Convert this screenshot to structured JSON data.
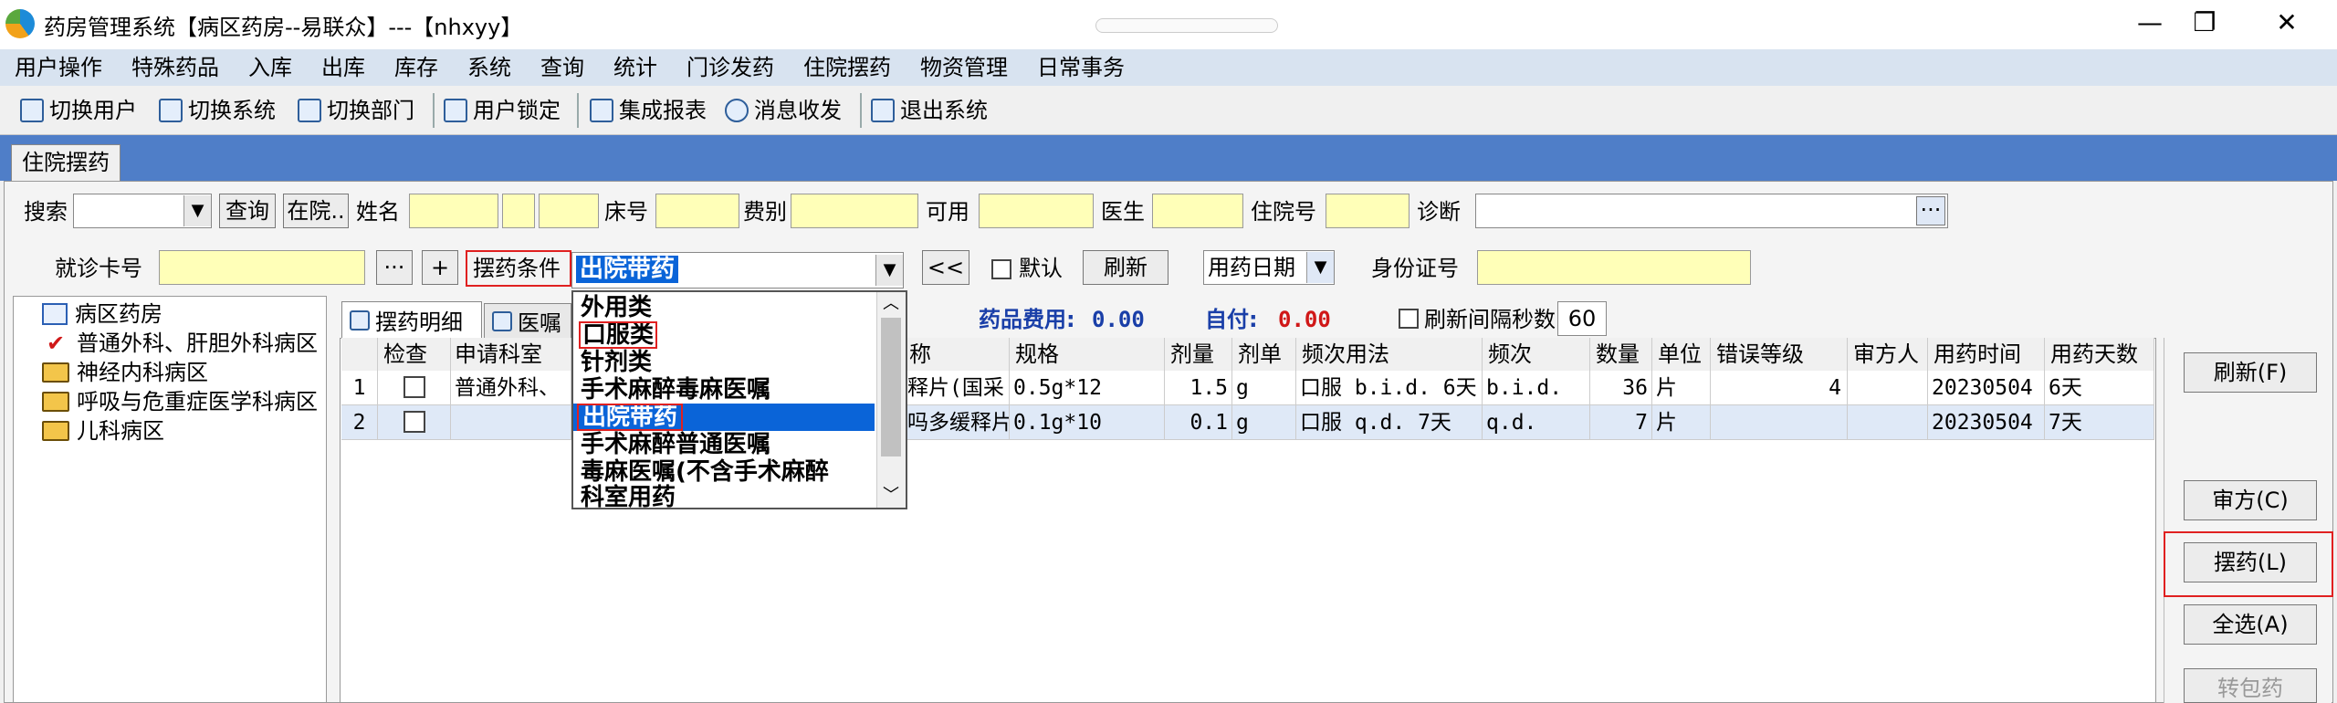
{
  "title_bar": {
    "title": "药房管理系统【病区药房--易联众】---【nhxyy】"
  },
  "menu": [
    "用户操作",
    "特殊药品",
    "入库",
    "出库",
    "库存",
    "系统",
    "查询",
    "统计",
    "门诊发药",
    "住院摆药",
    "物资管理",
    "日常事务"
  ],
  "toolbar": [
    "切换用户",
    "切换系统",
    "切换部门",
    "用户锁定",
    "集成报表",
    "消息收发",
    "退出系统"
  ],
  "tab": "住院摆药",
  "search": {
    "search_label": "搜索",
    "query_btn": "查询",
    "in_hosp_btn": "在院..",
    "name_label": "姓名",
    "bed_label": "床号",
    "fee_label": "费别",
    "available_label": "可用",
    "doctor_label": "医生",
    "inpatient_label": "住院号",
    "diagnosis_label": "诊断",
    "card_label": "就诊卡号",
    "dots": "···",
    "plus": "+",
    "condition_label": "摆药条件",
    "condition_value": "出院带药",
    "back_btn": "<<",
    "default_label": "默认",
    "refresh_btn": "刷新",
    "date_mode": "用药日期",
    "id_label": "身份证号"
  },
  "tree": [
    "病区药房",
    "普通外科、肝胆外科病区",
    "神经内科病区",
    "呼吸与危重症医学科病区",
    "儿科病区"
  ],
  "detail_tabs": [
    "摆药明细",
    "医嘱"
  ],
  "summary": {
    "fee_label": "药品费用:",
    "fee_value": "0.00",
    "self_label": "自付:",
    "self_value": "0.00",
    "interval_label": "刷新间隔秒数",
    "interval_value": "60"
  },
  "grid": {
    "headers": [
      "检查",
      "申请科室",
      "称",
      "规格",
      "剂量",
      "剂单",
      "频次用法",
      "频次",
      "数量",
      "单位",
      "错误等级",
      "审方人",
      "用药时间",
      "用药天数"
    ],
    "rows": [
      {
        "no": "1",
        "dept": "普通外科、",
        "name": "释片(国采",
        "spec": "0.5g*12",
        "dose": "1.5",
        "unit": "g",
        "usage": "口服 b.i.d. 6天",
        "freq": "b.i.d.",
        "qty": "36",
        "pkg": "片",
        "err": "4",
        "reviewer": "",
        "time": "20230504",
        "days": "6天"
      },
      {
        "no": "2",
        "dept": "",
        "name": "吗多缓释片",
        "spec": "0.1g*10",
        "dose": "0.1",
        "unit": "g",
        "usage": "口服 q.d. 7天",
        "freq": "q.d.",
        "qty": "7",
        "pkg": "片",
        "err": "",
        "reviewer": "",
        "time": "20230504",
        "days": "7天"
      }
    ]
  },
  "dropdown": [
    "外用类",
    "口服类",
    "针剂类",
    "手术麻醉毒麻医嘱",
    "出院带药",
    "手术麻醉普通医嘱",
    "毒麻医嘱(不含手术麻醉",
    "科室用药"
  ],
  "side_buttons": [
    "刷新(F)",
    "审方(C)",
    "摆药(L)",
    "全选(A)",
    "转包药"
  ],
  "window_controls": {
    "minimize": "—",
    "maximize": "❐",
    "close": "✕"
  },
  "colors": {
    "accent": "#4f7ec8",
    "highlight": "#0a64d8",
    "red": "#e02020",
    "blue_value": "#1a3fa8"
  }
}
